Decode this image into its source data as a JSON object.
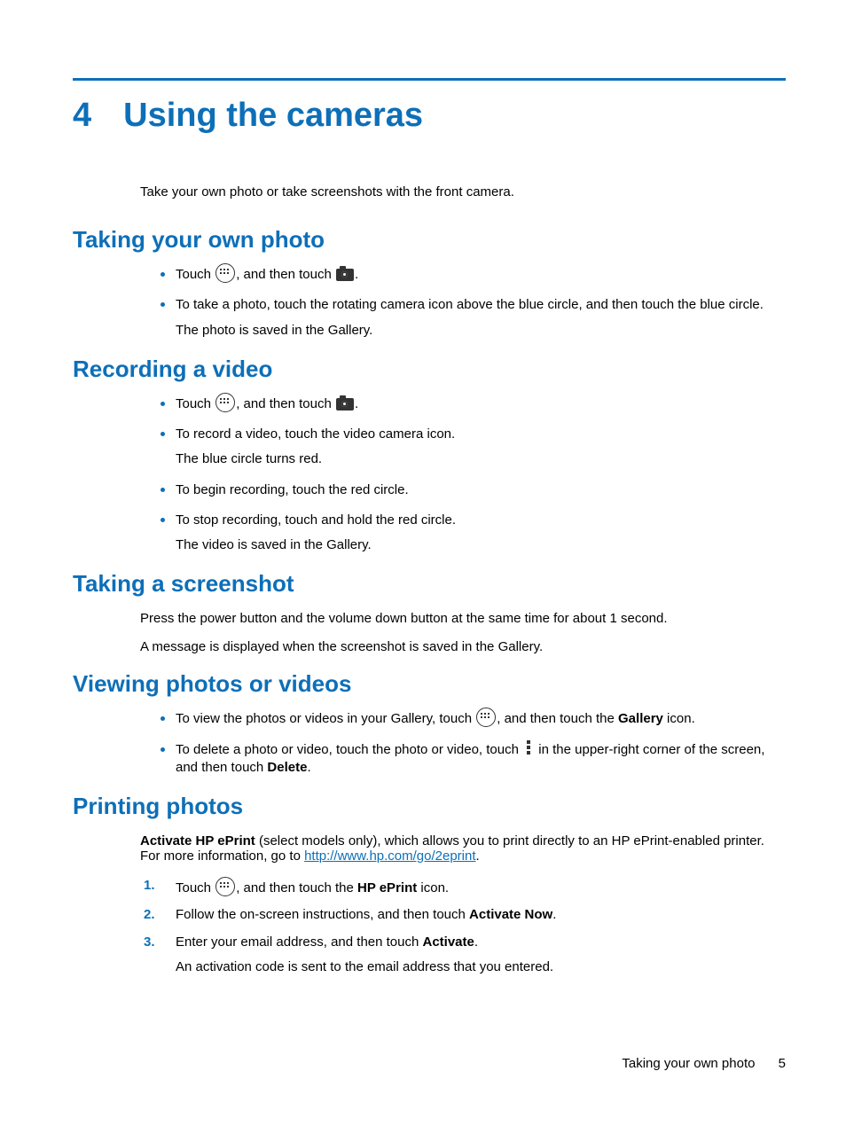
{
  "chapter": {
    "number": "4",
    "title": "Using the cameras"
  },
  "intro": "Take your own photo or take screenshots with the front camera.",
  "sec1": {
    "heading": "Taking your own photo",
    "b1a": "Touch ",
    "b1b": ", and then touch ",
    "b1c": ".",
    "b2": "To take a photo, touch the rotating camera icon above the blue circle, and then touch the blue circle.",
    "b2sub": "The photo is saved in the Gallery."
  },
  "sec2": {
    "heading": "Recording a video",
    "b1a": "Touch ",
    "b1b": ", and then touch ",
    "b1c": ".",
    "b2": "To record a video, touch the video camera icon.",
    "b2sub": "The blue circle turns red.",
    "b3": "To begin recording, touch the red circle.",
    "b4": "To stop recording, touch and hold the red circle.",
    "b4sub": "The video is saved in the Gallery."
  },
  "sec3": {
    "heading": "Taking a screenshot",
    "p1": "Press the power button and the volume down button at the same time for about 1 second.",
    "p2": "A message is displayed when the screenshot is saved in the Gallery."
  },
  "sec4": {
    "heading": "Viewing photos or videos",
    "b1a": "To view the photos or videos in your Gallery, touch ",
    "b1b": ", and then touch the ",
    "b1bold": "Gallery",
    "b1c": " icon.",
    "b2a": "To delete a photo or video, touch the photo or video, touch ",
    "b2b": " in the upper-right corner of the screen, and then touch ",
    "b2bold": "Delete",
    "b2c": "."
  },
  "sec5": {
    "heading": "Printing photos",
    "p_bold": "Activate HP ePrint",
    "p_rest": " (select models only), which allows you to print directly to an HP ePrint-enabled printer. For more information, go to ",
    "link": "http://www.hp.com/go/2eprint",
    "p_end": ".",
    "s1a": "Touch ",
    "s1b": ", and then touch the ",
    "s1bold": "HP ePrint",
    "s1c": " icon.",
    "s2a": "Follow the on-screen instructions, and then touch ",
    "s2bold": "Activate Now",
    "s2c": ".",
    "s3a": "Enter your email address, and then touch ",
    "s3bold": "Activate",
    "s3c": ".",
    "s3sub": "An activation code is sent to the email address that you entered."
  },
  "footer": {
    "text": "Taking your own photo",
    "page": "5"
  }
}
